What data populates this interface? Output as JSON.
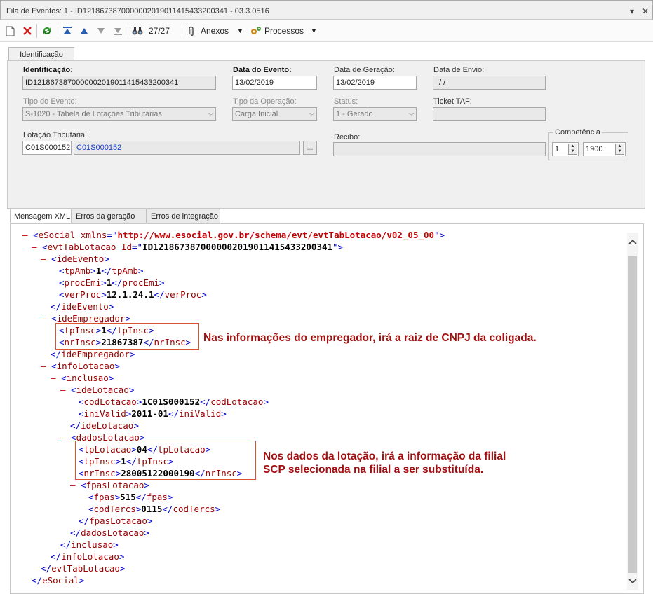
{
  "window": {
    "title": "Fila de Eventos: 1 - ID1218673870000002019011415433200341 - 03.3.0516",
    "pin_icon": "▾",
    "close_icon": "✕"
  },
  "toolbar": {
    "counter": "27/27",
    "anexos_label": "Anexos",
    "processos_label": "Processos"
  },
  "tabs": {
    "identificacao": "Identificação"
  },
  "form": {
    "identificacao_label": "Identificação:",
    "identificacao_value": "ID1218673870000002019011415433200341",
    "data_evento_label": "Data do Evento:",
    "data_evento_value": "13/02/2019",
    "data_geracao_label": "Data de Geração:",
    "data_geracao_value": "13/02/2019",
    "data_envio_label": "Data de Envio:",
    "data_envio_value": " / /",
    "tipo_evento_label": "Tipo do Evento:",
    "tipo_evento_value": "S-1020 - Tabela de Lotações Tributárias",
    "tipo_operacao_label": "Tipo da Operação:",
    "tipo_operacao_value": "Carga Inicial",
    "status_label": "Status:",
    "status_value": "1 - Gerado",
    "ticket_label": "Ticket TAF:",
    "ticket_value": "",
    "lotacao_label": "Lotação Tributária:",
    "lotacao_code": "C01S000152",
    "lotacao_link": "C01S000152",
    "lotacao_btn": "...",
    "recibo_label": "Recibo:",
    "recibo_value": "",
    "competencia_label": "Competência",
    "competencia_mes": "1",
    "competencia_ano": "1900"
  },
  "xml_tabs": [
    "Mensagem XML",
    "Erros da geração",
    "Erros de integração"
  ],
  "xml": {
    "esocial_tag": "eSocial",
    "esocial_attr": "xmlns",
    "esocial_ns": "http://www.esocial.gov.br/schema/evt/evtTabLotacao/v02_05_00",
    "evt_tag": "evtTabLotacao",
    "evt_attr": "Id",
    "evt_id": "ID1218673870000002019011415433200341",
    "ideEvento": "ideEvento",
    "tpAmb": "tpAmb",
    "tpAmb_val": "1",
    "procEmi": "procEmi",
    "procEmi_val": "1",
    "verProc": "verProc",
    "verProc_val": "12.1.24.1",
    "ideEmpregador": "ideEmpregador",
    "tpInsc": "tpInsc",
    "emp_tpInsc_val": "1",
    "nrInsc": "nrInsc",
    "emp_nrInsc_val": "21867387",
    "infoLotacao": "infoLotacao",
    "inclusao": "inclusao",
    "ideLotacao": "ideLotacao",
    "codLotacao": "codLotacao",
    "codLotacao_val": "1C01S000152",
    "iniValid": "iniValid",
    "iniValid_val": "2011-01",
    "dadosLotacao": "dadosLotacao",
    "tpLotacao": "tpLotacao",
    "tpLotacao_val": "04",
    "lot_tpInsc_val": "1",
    "lot_nrInsc_val": "28005122000190",
    "fpasLotacao": "fpasLotacao",
    "fpas": "fpas",
    "fpas_val": "515",
    "codTercs": "codTercs",
    "codTercs_val": "0115"
  },
  "annotations": {
    "empregador": "Nas informações do empregador, irá a raiz de CNPJ da coligada.",
    "lotacao_line1": "Nos dados da lotação, irá a informação da filial",
    "lotacao_line2": "SCP selecionada na filial a ser substituída."
  }
}
